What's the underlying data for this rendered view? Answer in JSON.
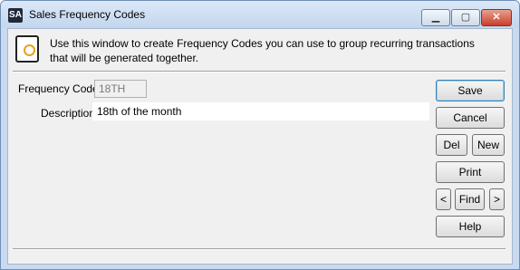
{
  "window": {
    "icon_text": "SA",
    "title": "Sales Frequency Codes",
    "minimize": "▁",
    "maximize": "▢",
    "close": "✕"
  },
  "info": {
    "icon": "document-info-icon",
    "text": "Use this window to create Frequency Codes you can use to group recurring transactions that will be generated together."
  },
  "form": {
    "frequency_code_label": "Frequency Code",
    "frequency_code_value": "18TH",
    "description_label": "Description",
    "description_value": "18th of the month"
  },
  "buttons": {
    "save": "Save",
    "cancel": "Cancel",
    "del": "Del",
    "new": "New",
    "print": "Print",
    "prev": "<",
    "find": "Find",
    "next": ">",
    "help": "Help"
  }
}
